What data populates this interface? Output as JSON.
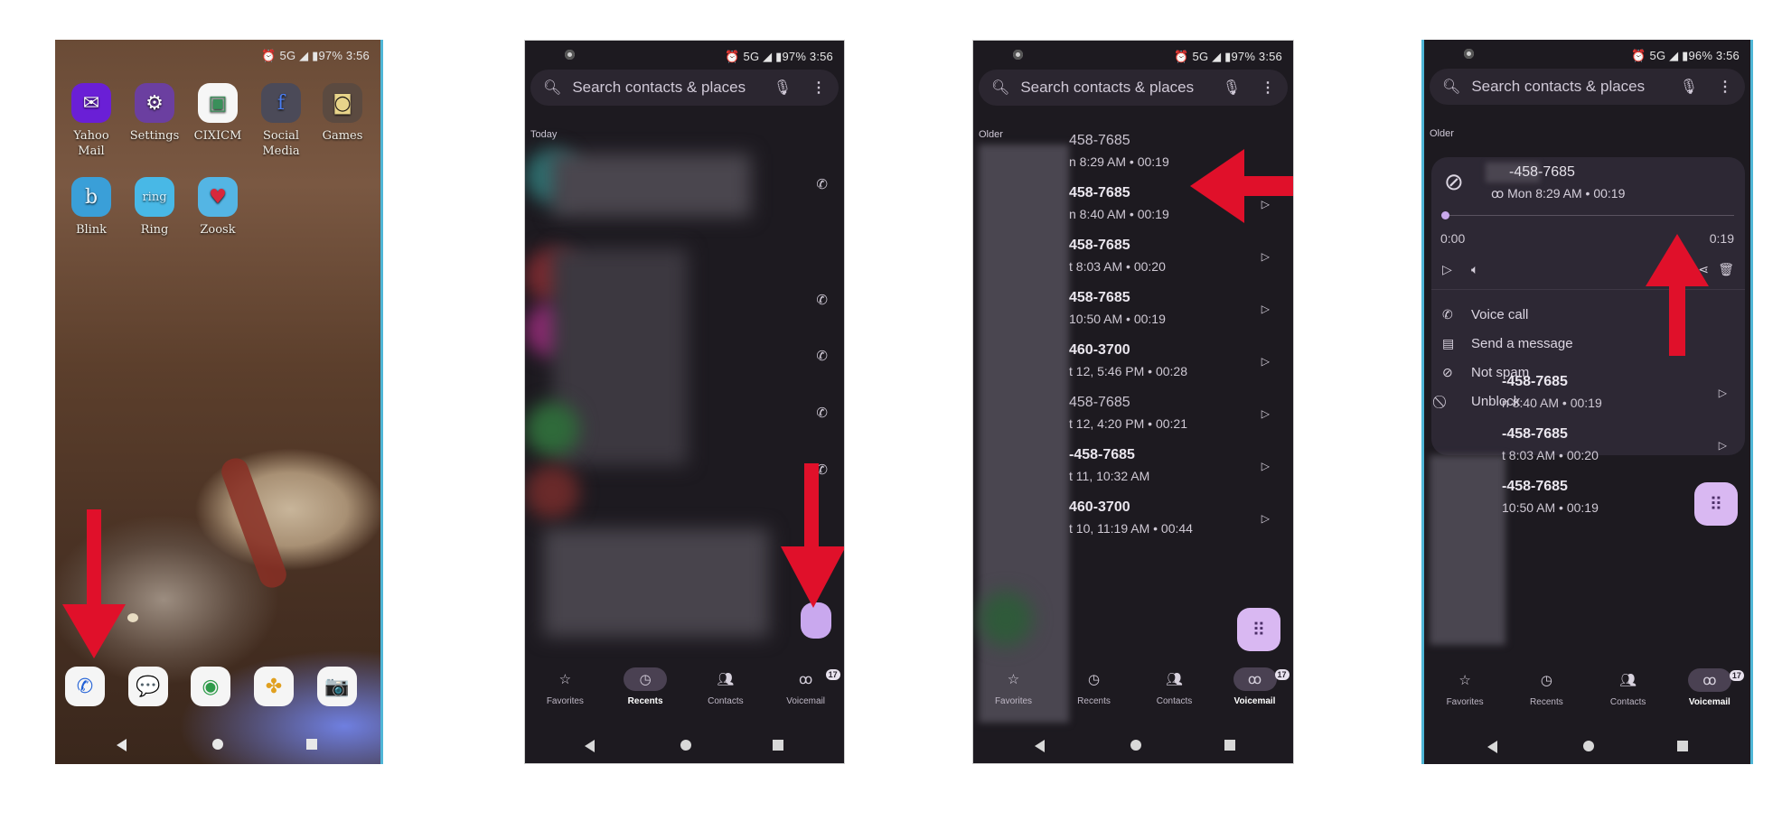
{
  "status_bar": {
    "p1": "⏰ 5G ◢ ▮97% 3:56",
    "p2": "⏰ 5G ◢ ▮97% 3:56",
    "p3": "⏰ 5G ◢ ▮97% 3:56",
    "p4": "⏰ 5G ◢ ▮96% 3:56"
  },
  "home": {
    "apps": [
      {
        "label": "Yahoo Mail",
        "icon": "yahoo-mail-icon",
        "glyph": "✉",
        "bg": "#6a1fd6",
        "fg": "#ffffff"
      },
      {
        "label": "Settings",
        "icon": "settings-icon",
        "glyph": "⚙",
        "bg": "#6b3fa0",
        "fg": "#ffffff"
      },
      {
        "label": "CIXICM",
        "icon": "cixicm-icon",
        "glyph": "▣",
        "bg": "#f6f6f6",
        "fg": "#3a8f5a"
      },
      {
        "label": "Social Media",
        "icon": "folder-icon",
        "glyph": "f",
        "bg": "#4b4a58",
        "fg": "#4a7df0"
      },
      {
        "label": "Games",
        "icon": "folder-icon",
        "glyph": "◙",
        "bg": "#5b4a40",
        "fg": "#e8d48a"
      },
      {
        "label": "Blink",
        "icon": "blink-icon",
        "glyph": "b",
        "bg": "#3a9fd8",
        "fg": "#e8f6ff"
      },
      {
        "label": "Ring",
        "icon": "ring-icon",
        "glyph": "ring",
        "bg": "#48b8e6",
        "fg": "#d8f2ff"
      },
      {
        "label": "Zoosk",
        "icon": "zoosk-icon",
        "glyph": "♥",
        "bg": "#54b5e4",
        "fg": "#d8283c"
      }
    ],
    "dock": [
      {
        "icon": "phone-icon",
        "glyph": "✆",
        "fg": "#1f5fd6"
      },
      {
        "icon": "messages-icon",
        "glyph": "💬",
        "fg": "#2b6be0"
      },
      {
        "icon": "chrome-icon",
        "glyph": "◉",
        "fg": "#2f9b4a"
      },
      {
        "icon": "photos-icon",
        "glyph": "✤",
        "fg": "#e0a020"
      },
      {
        "icon": "camera-icon",
        "glyph": "📷",
        "fg": "#1a2a3a"
      }
    ]
  },
  "dialer": {
    "search_placeholder": "Search contacts & places",
    "section_today": "Today",
    "section_older": "Older",
    "tabs": [
      "Favorites",
      "Recents",
      "Contacts",
      "Voicemail"
    ],
    "voicemail_badge": "17"
  },
  "voicemails": [
    {
      "number": "458-7685",
      "meta": "n 8:29 AM • 00:19",
      "bold": false
    },
    {
      "number": "458-7685",
      "meta": "n 8:40 AM • 00:19",
      "bold": true
    },
    {
      "number": "458-7685",
      "meta": "t 8:03 AM • 00:20",
      "bold": true
    },
    {
      "number": "458-7685",
      "meta": "10:50 AM • 00:19",
      "bold": true
    },
    {
      "number": "460-3700",
      "meta": "t 12, 5:46 PM • 00:28",
      "bold": true
    },
    {
      "number": "458-7685",
      "meta": "t 12, 4:20 PM • 00:21",
      "bold": false
    },
    {
      "number": "-458-7685",
      "meta": "t 11, 10:32 AM",
      "bold": true
    },
    {
      "number": "460-3700",
      "meta": "t 10, 11:19 AM • 00:44",
      "bold": true
    }
  ],
  "expanded": {
    "number": "-458-7685",
    "meta": "ꝏ Mon 8:29 AM • 00:19",
    "time_start": "0:00",
    "time_end": "0:19",
    "progress": 0,
    "menu": [
      {
        "label": "Voice call",
        "icon": "phone-icon",
        "glyph": "✆"
      },
      {
        "label": "Send a message",
        "icon": "message-icon",
        "glyph": "▤"
      },
      {
        "label": "Not spam",
        "icon": "not-spam-icon",
        "glyph": "⊘"
      },
      {
        "label": "Unblock",
        "icon": "unblock-icon",
        "glyph": "⃠"
      }
    ],
    "below": [
      {
        "number": "-458-7685",
        "meta": "n 8:40 AM • 00:19"
      },
      {
        "number": "-458-7685",
        "meta": "t 8:03 AM • 00:20"
      },
      {
        "number": "-458-7685",
        "meta": "10:50 AM • 00:19"
      }
    ]
  },
  "colors": {
    "annotation_arrow": "#e0102a",
    "dialer_bg": "#1d1a20",
    "fab": "#d9b8f2",
    "frame_accent": "#4fb6d6"
  }
}
